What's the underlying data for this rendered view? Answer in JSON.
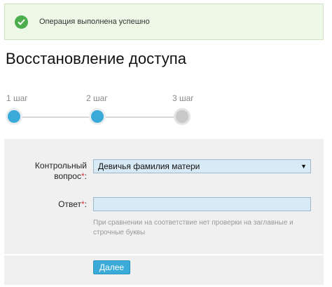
{
  "alert": {
    "message": "Операция выполнена успешно",
    "icon": "checkmark-icon",
    "color": "#4cae4c"
  },
  "title": "Восстановление доступа",
  "steps": [
    {
      "label": "1 шаг",
      "state": "done"
    },
    {
      "label": "2 шаг",
      "state": "done"
    },
    {
      "label": "3 шаг",
      "state": "todo"
    }
  ],
  "form": {
    "question_label_line1": "Контрольный",
    "question_label_line2": "вопрос",
    "question_selected": "Девичья фамилия матери",
    "answer_label": "Ответ",
    "answer_value": "",
    "required_mark": "*",
    "hint": "При сравнении на соответствие нет проверки на заглавные и строчные буквы",
    "submit_label": "Далее"
  },
  "colors": {
    "accent": "#3aabd9",
    "required": "#e03030",
    "success_bg": "#eef8e7"
  }
}
